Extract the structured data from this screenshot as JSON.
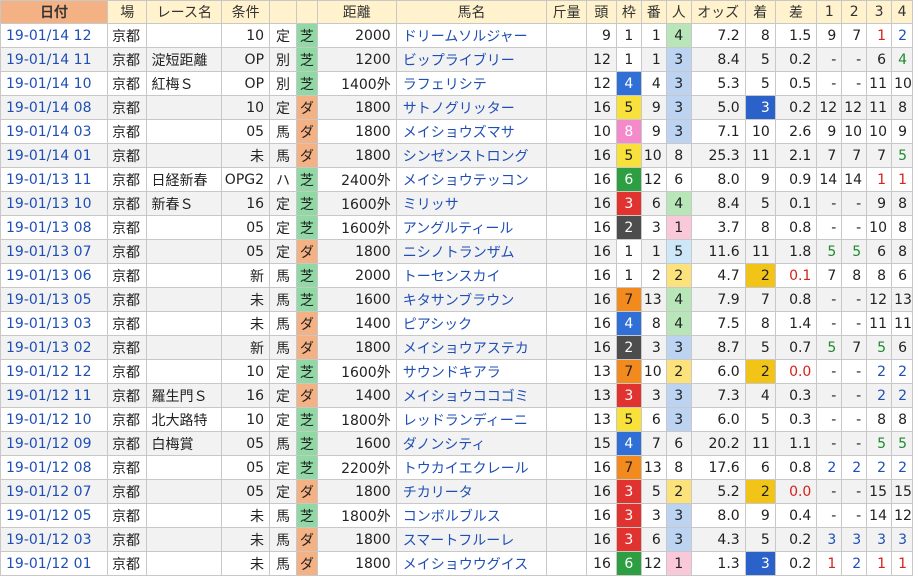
{
  "headers": {
    "date": "日付",
    "venue": "場",
    "race": "レース名",
    "cond": "条件",
    "dist": "距離",
    "horse": "馬名",
    "kinryo": "斤量",
    "heads": "頭",
    "waku": "枠",
    "ban": "番",
    "pop": "人",
    "odds": "オッズ",
    "finish": "着",
    "diff": "差",
    "c1": "1",
    "c2": "2",
    "c3": "3",
    "c4": "4"
  },
  "rows": [
    {
      "date": "19-01/14 12",
      "venue": "京都",
      "race": "",
      "cond": "10",
      "type": "定",
      "surface": "芝",
      "dist": "2000",
      "horse": "ドリームソルジャー",
      "heads": "9",
      "waku": "1",
      "ban": "1",
      "pop": "4",
      "odds": "7.2",
      "finish": "8",
      "diff": "1.5",
      "c1": "9",
      "c2": "7",
      "c3": "1",
      "c4": "2"
    },
    {
      "date": "19-01/14 11",
      "venue": "京都",
      "race": "淀短距離",
      "cond": "OP",
      "type": "別",
      "surface": "芝",
      "dist": "1200",
      "horse": "ビップライブリー",
      "heads": "12",
      "waku": "1",
      "ban": "1",
      "pop": "3",
      "odds": "8.4",
      "finish": "5",
      "diff": "0.2",
      "c1": "-",
      "c2": "-",
      "c3": "6",
      "c4": "4"
    },
    {
      "date": "19-01/14 10",
      "venue": "京都",
      "race": "紅梅Ｓ",
      "cond": "OP",
      "type": "別",
      "surface": "芝",
      "dist": "1400外",
      "horse": "ラフェリシテ",
      "heads": "12",
      "waku": "4",
      "ban": "4",
      "pop": "3",
      "odds": "5.3",
      "finish": "5",
      "diff": "0.5",
      "c1": "-",
      "c2": "-",
      "c3": "11",
      "c4": "10"
    },
    {
      "date": "19-01/14 08",
      "venue": "京都",
      "race": "",
      "cond": "10",
      "type": "定",
      "surface": "ダ",
      "dist": "1800",
      "horse": "サトノグリッター",
      "heads": "16",
      "waku": "5",
      "ban": "9",
      "pop": "3",
      "odds": "5.0",
      "finish": "3",
      "diff": "0.2",
      "c1": "12",
      "c2": "12",
      "c3": "11",
      "c4": "8"
    },
    {
      "date": "19-01/14 03",
      "venue": "京都",
      "race": "",
      "cond": "05",
      "type": "馬",
      "surface": "ダ",
      "dist": "1800",
      "horse": "メイショウズマサ",
      "heads": "10",
      "waku": "8",
      "ban": "9",
      "pop": "3",
      "odds": "7.1",
      "finish": "10",
      "diff": "2.6",
      "c1": "9",
      "c2": "10",
      "c3": "10",
      "c4": "9"
    },
    {
      "date": "19-01/14 01",
      "venue": "京都",
      "race": "",
      "cond": "未",
      "type": "馬",
      "surface": "ダ",
      "dist": "1800",
      "horse": "シンゼンストロング",
      "heads": "16",
      "waku": "5",
      "ban": "10",
      "pop": "8",
      "odds": "25.3",
      "finish": "11",
      "diff": "2.1",
      "c1": "7",
      "c2": "7",
      "c3": "7",
      "c4": "5"
    },
    {
      "date": "19-01/13 11",
      "venue": "京都",
      "race": "日経新春",
      "cond": "OPG2",
      "type": "ハ",
      "surface": "芝",
      "dist": "2400外",
      "horse": "メイショウテッコン",
      "heads": "16",
      "waku": "6",
      "ban": "12",
      "pop": "6",
      "odds": "8.0",
      "finish": "9",
      "diff": "0.9",
      "c1": "14",
      "c2": "14",
      "c3": "1",
      "c4": "1"
    },
    {
      "date": "19-01/13 10",
      "venue": "京都",
      "race": "新春Ｓ",
      "cond": "16",
      "type": "定",
      "surface": "芝",
      "dist": "1600外",
      "horse": "ミリッサ",
      "heads": "16",
      "waku": "3",
      "ban": "6",
      "pop": "4",
      "odds": "8.4",
      "finish": "5",
      "diff": "0.1",
      "c1": "-",
      "c2": "-",
      "c3": "9",
      "c4": "8"
    },
    {
      "date": "19-01/13 08",
      "venue": "京都",
      "race": "",
      "cond": "05",
      "type": "定",
      "surface": "芝",
      "dist": "1600外",
      "horse": "アングルティール",
      "heads": "16",
      "waku": "2",
      "ban": "3",
      "pop": "1",
      "odds": "3.7",
      "finish": "8",
      "diff": "0.8",
      "c1": "-",
      "c2": "-",
      "c3": "10",
      "c4": "8"
    },
    {
      "date": "19-01/13 07",
      "venue": "京都",
      "race": "",
      "cond": "05",
      "type": "定",
      "surface": "ダ",
      "dist": "1800",
      "horse": "ニシノトランザム",
      "heads": "16",
      "waku": "1",
      "ban": "1",
      "pop": "5",
      "odds": "11.6",
      "finish": "11",
      "diff": "1.8",
      "c1": "5",
      "c2": "5",
      "c3": "6",
      "c4": "8"
    },
    {
      "date": "19-01/13 06",
      "venue": "京都",
      "race": "",
      "cond": "新",
      "type": "馬",
      "surface": "芝",
      "dist": "2000",
      "horse": "トーセンスカイ",
      "heads": "16",
      "waku": "1",
      "ban": "2",
      "pop": "2",
      "odds": "4.7",
      "finish": "2",
      "diff": "0.1",
      "c1": "7",
      "c2": "8",
      "c3": "8",
      "c4": "6"
    },
    {
      "date": "19-01/13 05",
      "venue": "京都",
      "race": "",
      "cond": "未",
      "type": "馬",
      "surface": "芝",
      "dist": "1600",
      "horse": "キタサンブラウン",
      "heads": "16",
      "waku": "7",
      "ban": "13",
      "pop": "4",
      "odds": "7.9",
      "finish": "7",
      "diff": "0.8",
      "c1": "-",
      "c2": "-",
      "c3": "12",
      "c4": "13"
    },
    {
      "date": "19-01/13 03",
      "venue": "京都",
      "race": "",
      "cond": "未",
      "type": "馬",
      "surface": "ダ",
      "dist": "1400",
      "horse": "ピアシック",
      "heads": "16",
      "waku": "4",
      "ban": "8",
      "pop": "4",
      "odds": "7.5",
      "finish": "8",
      "diff": "1.4",
      "c1": "-",
      "c2": "-",
      "c3": "11",
      "c4": "11"
    },
    {
      "date": "19-01/13 02",
      "venue": "京都",
      "race": "",
      "cond": "新",
      "type": "馬",
      "surface": "ダ",
      "dist": "1800",
      "horse": "メイショウアステカ",
      "heads": "16",
      "waku": "2",
      "ban": "3",
      "pop": "3",
      "odds": "8.7",
      "finish": "5",
      "diff": "0.7",
      "c1": "5",
      "c2": "7",
      "c3": "5",
      "c4": "6"
    },
    {
      "date": "19-01/12 12",
      "venue": "京都",
      "race": "",
      "cond": "10",
      "type": "定",
      "surface": "芝",
      "dist": "1600外",
      "horse": "サウンドキアラ",
      "heads": "13",
      "waku": "7",
      "ban": "10",
      "pop": "2",
      "odds": "6.0",
      "finish": "2",
      "diff": "0.0",
      "c1": "-",
      "c2": "-",
      "c3": "2",
      "c4": "2"
    },
    {
      "date": "19-01/12 11",
      "venue": "京都",
      "race": "羅生門Ｓ",
      "cond": "16",
      "type": "定",
      "surface": "ダ",
      "dist": "1400",
      "horse": "メイショウココゴミ",
      "heads": "13",
      "waku": "3",
      "ban": "3",
      "pop": "3",
      "odds": "7.3",
      "finish": "4",
      "diff": "0.3",
      "c1": "-",
      "c2": "-",
      "c3": "2",
      "c4": "2"
    },
    {
      "date": "19-01/12 10",
      "venue": "京都",
      "race": "北大路特",
      "cond": "10",
      "type": "定",
      "surface": "芝",
      "dist": "1800外",
      "horse": "レッドランディーニ",
      "heads": "13",
      "waku": "5",
      "ban": "6",
      "pop": "3",
      "odds": "6.0",
      "finish": "5",
      "diff": "0.3",
      "c1": "-",
      "c2": "-",
      "c3": "8",
      "c4": "8"
    },
    {
      "date": "19-01/12 09",
      "venue": "京都",
      "race": "白梅賞",
      "cond": "05",
      "type": "馬",
      "surface": "芝",
      "dist": "1600",
      "horse": "ダノンシティ",
      "heads": "15",
      "waku": "4",
      "ban": "7",
      "pop": "6",
      "odds": "20.2",
      "finish": "11",
      "diff": "1.1",
      "c1": "-",
      "c2": "-",
      "c3": "5",
      "c4": "5"
    },
    {
      "date": "19-01/12 08",
      "venue": "京都",
      "race": "",
      "cond": "05",
      "type": "定",
      "surface": "芝",
      "dist": "2200外",
      "horse": "トウカイエクレール",
      "heads": "16",
      "waku": "7",
      "ban": "13",
      "pop": "8",
      "odds": "17.6",
      "finish": "6",
      "diff": "0.8",
      "c1": "2",
      "c2": "2",
      "c3": "2",
      "c4": "2"
    },
    {
      "date": "19-01/12 07",
      "venue": "京都",
      "race": "",
      "cond": "05",
      "type": "定",
      "surface": "ダ",
      "dist": "1800",
      "horse": "チカリータ",
      "heads": "16",
      "waku": "3",
      "ban": "5",
      "pop": "2",
      "odds": "5.2",
      "finish": "2",
      "diff": "0.0",
      "c1": "-",
      "c2": "-",
      "c3": "15",
      "c4": "15"
    },
    {
      "date": "19-01/12 05",
      "venue": "京都",
      "race": "",
      "cond": "未",
      "type": "馬",
      "surface": "芝",
      "dist": "1800外",
      "horse": "コンボルブルス",
      "heads": "16",
      "waku": "3",
      "ban": "3",
      "pop": "3",
      "odds": "8.0",
      "finish": "9",
      "diff": "0.4",
      "c1": "-",
      "c2": "-",
      "c3": "14",
      "c4": "12"
    },
    {
      "date": "19-01/12 03",
      "venue": "京都",
      "race": "",
      "cond": "未",
      "type": "馬",
      "surface": "ダ",
      "dist": "1800",
      "horse": "スマートフルーレ",
      "heads": "16",
      "waku": "3",
      "ban": "6",
      "pop": "3",
      "odds": "4.3",
      "finish": "5",
      "diff": "0.2",
      "c1": "3",
      "c2": "3",
      "c3": "3",
      "c4": "3"
    },
    {
      "date": "19-01/12 01",
      "venue": "京都",
      "race": "",
      "cond": "未",
      "type": "馬",
      "surface": "ダ",
      "dist": "1800",
      "horse": "メイショウウグイス",
      "heads": "16",
      "waku": "6",
      "ban": "12",
      "pop": "1",
      "odds": "1.3",
      "finish": "3",
      "diff": "0.2",
      "c1": "1",
      "c2": "2",
      "c3": "1",
      "c4": "1"
    }
  ]
}
